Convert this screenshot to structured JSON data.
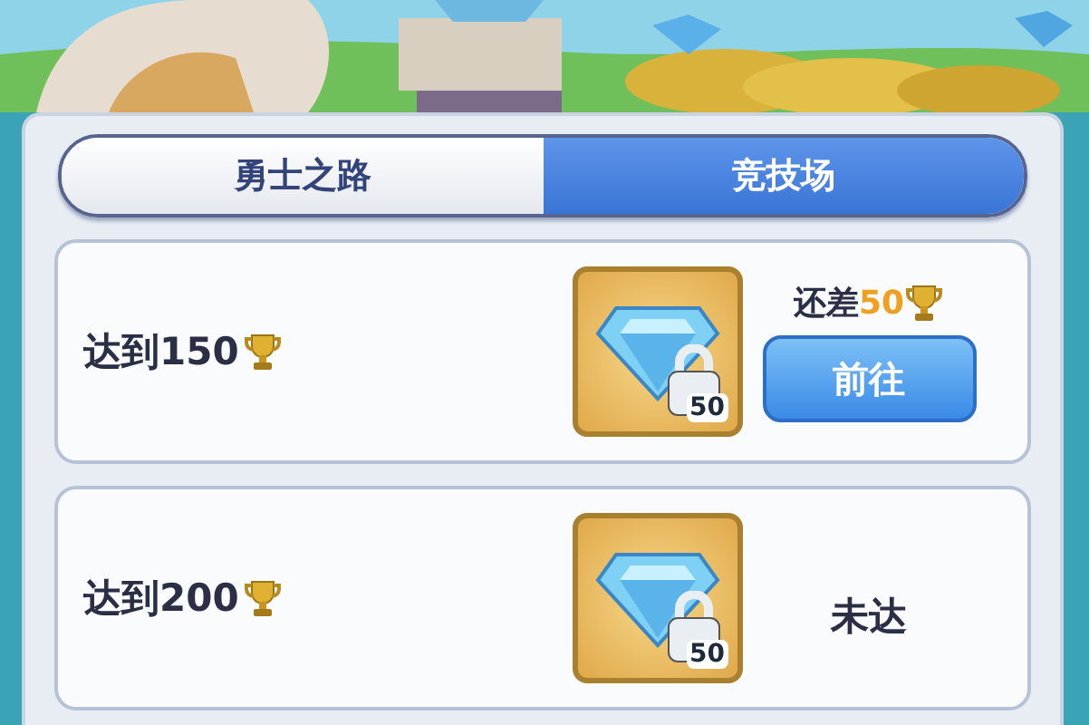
{
  "tabs": [
    {
      "label": "勇士之路",
      "selected": false
    },
    {
      "label": "竞技场",
      "selected": true
    }
  ],
  "rewards": [
    {
      "goal": "达到150",
      "reward_count": "50",
      "locked": true,
      "status": {
        "kind": "progress",
        "prefix": "还差",
        "amount": "50",
        "button": "前往"
      }
    },
    {
      "goal": "达到200",
      "reward_count": "50",
      "locked": true,
      "status": {
        "kind": "unreached",
        "text": "未达"
      }
    }
  ]
}
